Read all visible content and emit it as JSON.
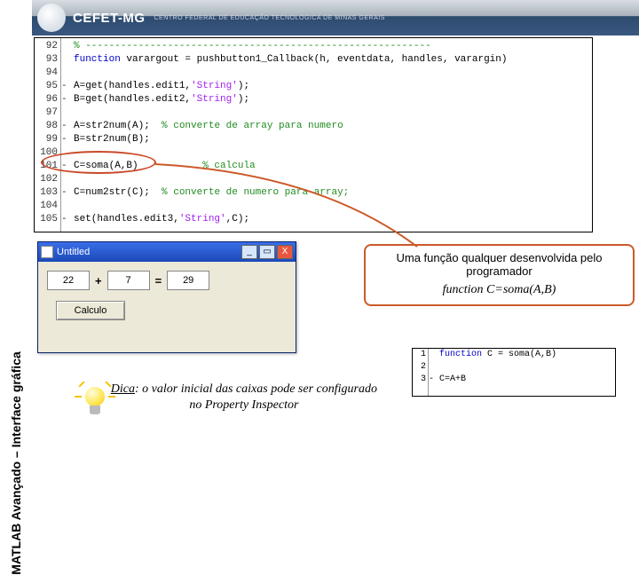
{
  "brand": {
    "logo_text": "CEFET-MG",
    "subtitle": "CENTRO FEDERAL DE EDUCAÇÃO TECNOLÓGICA DE MINAS GERAIS"
  },
  "sidebar": {
    "caption": "MATLAB  Avançado – Interface gráfica"
  },
  "editor": {
    "lines": [
      "92",
      "93",
      "94",
      "95",
      "96",
      "97",
      "98",
      "99",
      "100",
      "101",
      "102",
      "103",
      "104",
      "105"
    ],
    "dashes": [
      "",
      "",
      "",
      "-",
      "-",
      "",
      "-",
      "-",
      "",
      "-",
      "",
      "-",
      "",
      "-"
    ],
    "code92": "% -----------------------------------------------------------",
    "code93a": "function",
    "code93b": " varargout = pushbutton1_Callback(h, eventdata, handles, varargin)",
    "code95a": "A=get(handles.edit1,",
    "code95b": "'String'",
    "code95c": ");",
    "code96a": "B=get(handles.edit2,",
    "code96b": "'String'",
    "code96c": ");",
    "code98a": "A=str2num(A);  ",
    "code98b": "% converte de array para numero",
    "code99": "B=str2num(B);",
    "code101a": "C=soma(A,B)           ",
    "code101b": "% calcula",
    "code103a": "C=num2str(C);  ",
    "code103b": "% converte de numero para array;",
    "code105a": "set(handles.edit3,",
    "code105b": "'String'",
    "code105c": ",C);"
  },
  "gui": {
    "title": "Untitled",
    "val_a": "22",
    "op_plus": "+",
    "val_b": "7",
    "op_eq": "=",
    "val_c": "29",
    "calc_label": "Calculo"
  },
  "note": {
    "line1": "Uma função qualquer desenvolvida pelo programador",
    "line2": "function C=soma(A,B)"
  },
  "snippet": {
    "lines": [
      "1",
      "2",
      "3"
    ],
    "dashes": [
      "",
      "",
      "-"
    ],
    "l1a": "function",
    "l1b": " C = soma(A,B)",
    "l3": "C=A+B"
  },
  "tip": {
    "label": "Dica",
    "text": ": o valor inicial das caixas pode ser configurado no Property Inspector"
  }
}
